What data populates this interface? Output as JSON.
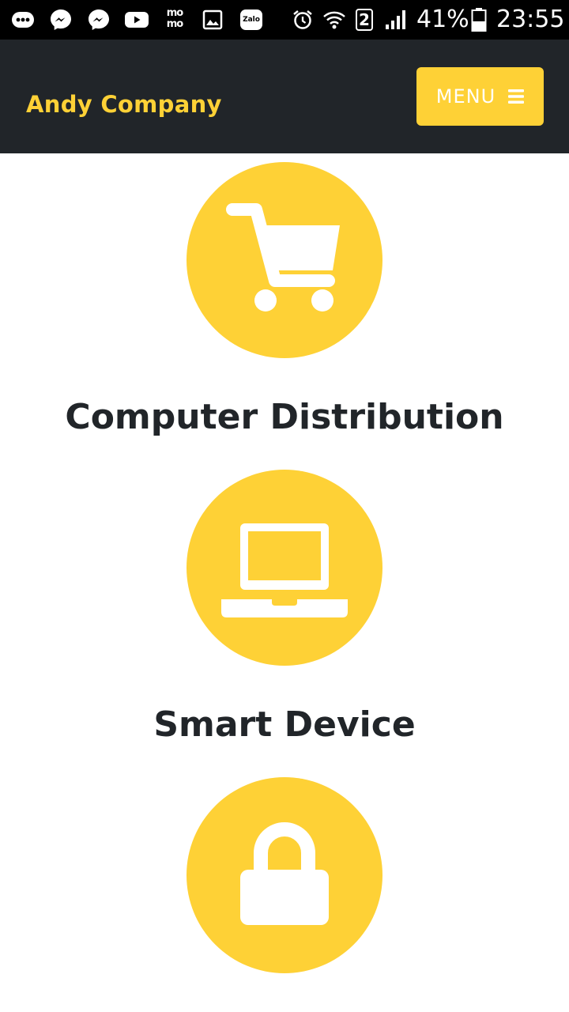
{
  "status_bar": {
    "battery": "41%",
    "time": "23:55",
    "sim_slot": "2",
    "momo_text": "mo mo",
    "zalo_text": "Zalo",
    "icons": [
      "more-dots-icon",
      "messenger-icon",
      "messenger-icon",
      "youtube-icon",
      "momo-icon",
      "gallery-icon",
      "zalo-icon",
      "alarm-icon",
      "wifi-icon",
      "sim-2-icon",
      "signal-icon",
      "battery-icon"
    ]
  },
  "navbar": {
    "brand": "Andy Company",
    "menu_label": "MENU",
    "menu_icon": "bars-icon"
  },
  "services": [
    {
      "title": "Computer Distribution",
      "icon": "shopping-cart-icon"
    },
    {
      "title": "Smart Device",
      "icon": "laptop-icon"
    },
    {
      "title": "",
      "icon": "lock-icon"
    }
  ],
  "colors": {
    "accent": "#fed136",
    "navbar_bg": "#212529",
    "heading": "#212529",
    "status_bar_bg": "#000000"
  }
}
